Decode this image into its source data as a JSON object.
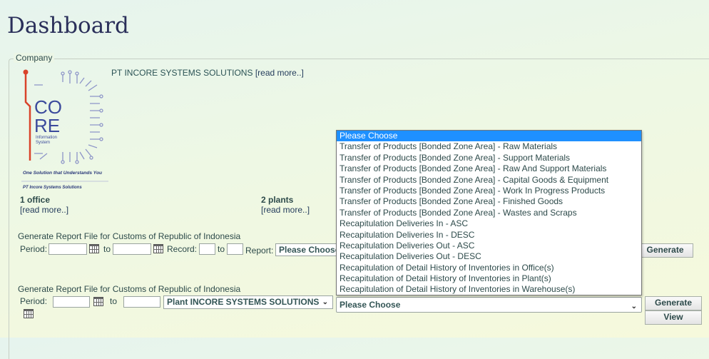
{
  "page": {
    "title": "Dashboard"
  },
  "company": {
    "legend": "Company",
    "name": "PT INCORE SYSTEMS SOLUTIONS",
    "read_more": "[read more..]",
    "logo": {
      "line1": "CO",
      "line2": "RE",
      "sub1": "Information",
      "sub2": "System",
      "tagline": "One Solution that Understands You",
      "footer": "PT Incore Systems Solutions"
    },
    "offices": {
      "count": "1 office",
      "read_more": "[read more..]"
    },
    "plants": {
      "count": "2 plants",
      "read_more": "[read more..]"
    }
  },
  "report1": {
    "heading": "Generate Report File for Customs of Republic of Indonesia",
    "period_label": "Period:",
    "to_label": "to",
    "record_label": "Record:",
    "record_to_label": "to",
    "report_label": "Report:",
    "report_select": "Please Choose",
    "generate": "Generate"
  },
  "report2": {
    "heading": "Generate Report File for Customs of Republic of Indonesia",
    "period_label": "Period:",
    "to_label": "to",
    "plant_select": "Plant INCORE SYSTEMS SOLUTIONS",
    "report_select": "Please Choose",
    "generate": "Generate",
    "view": "View"
  },
  "dropdown": {
    "selected_index": 0,
    "options": [
      "Please Choose",
      "Transfer of Products [Bonded Zone Area] - Raw Materials",
      "Transfer of Products [Bonded Zone Area] - Support Materials",
      "Transfer of Products [Bonded Zone Area] - Raw And Support Materials",
      "Transfer of Products [Bonded Zone Area] - Capital Goods & Equipment",
      "Transfer of Products [Bonded Zone Area] - Work In Progress Products",
      "Transfer of Products [Bonded Zone Area] - Finished Goods",
      "Transfer of Products [Bonded Zone Area] - Wastes and Scraps",
      "Recapitulation Deliveries In - ASC",
      "Recapitulation Deliveries In - DESC",
      "Recapitulation Deliveries Out - ASC",
      "Recapitulation Deliveries Out - DESC",
      "Recapitulation of Detail History of Inventories in Office(s)",
      "Recapitulation of Detail History of Inventories in Plant(s)",
      "Recapitulation of Detail History of Inventories in Warehouse(s)"
    ]
  },
  "colors": {
    "selected_option": "#1e90ff",
    "title": "#2a2f5a"
  },
  "icons": {
    "calendar": "calendar-icon",
    "chevron": "chevron-down-icon"
  }
}
